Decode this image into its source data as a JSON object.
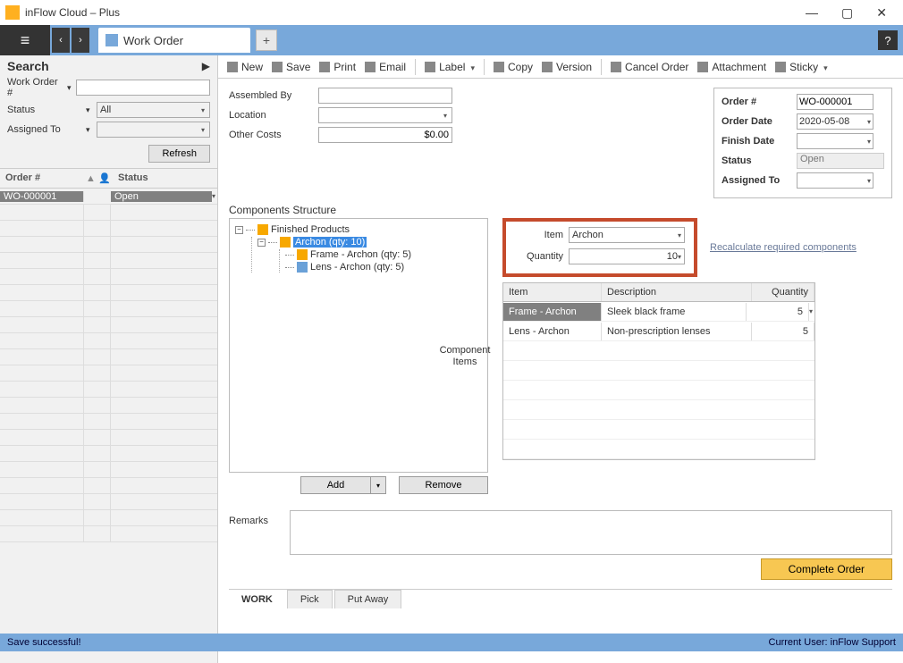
{
  "window": {
    "title": "inFlow Cloud – Plus"
  },
  "tabs": {
    "active": "Work Order",
    "add": "+"
  },
  "toolbar": {
    "new": "New",
    "save": "Save",
    "print": "Print",
    "email": "Email",
    "label": "Label",
    "copy": "Copy",
    "version": "Version",
    "cancel": "Cancel Order",
    "attachment": "Attachment",
    "sticky": "Sticky"
  },
  "search": {
    "heading": "Search",
    "fields": {
      "work_order_no": {
        "label": "Work Order #",
        "value": ""
      },
      "status": {
        "label": "Status",
        "value": "All"
      },
      "assigned_to": {
        "label": "Assigned To",
        "value": ""
      }
    },
    "refresh": "Refresh",
    "columns": {
      "order": "Order #",
      "status": "Status"
    },
    "rows": [
      {
        "order": "WO-000001",
        "status": "Open"
      }
    ]
  },
  "form": {
    "left": {
      "assembled_by": {
        "label": "Assembled By",
        "value": ""
      },
      "location": {
        "label": "Location",
        "value": ""
      },
      "other_costs": {
        "label": "Other Costs",
        "value": "$0.00"
      }
    },
    "right": {
      "order_no": {
        "label": "Order #",
        "value": "WO-000001"
      },
      "order_date": {
        "label": "Order Date",
        "value": "2020-05-08"
      },
      "finish_date": {
        "label": "Finish Date",
        "value": ""
      },
      "status": {
        "label": "Status",
        "value": "Open"
      },
      "assigned_to": {
        "label": "Assigned To",
        "value": ""
      }
    }
  },
  "components": {
    "heading": "Components Structure",
    "tree": {
      "root": "Finished Products",
      "product": "Archon  (qty: 10)",
      "children": [
        "Frame - Archon  (qty: 5)",
        "Lens - Archon  (qty: 5)"
      ]
    },
    "item_field": {
      "label": "Item",
      "value": "Archon"
    },
    "qty_field": {
      "label": "Quantity",
      "value": "10"
    },
    "recalc": "Recalculate required components",
    "component_items_label": "Component Items",
    "grid": {
      "headers": {
        "item": "Item",
        "desc": "Description",
        "qty": "Quantity"
      },
      "rows": [
        {
          "item": "Frame - Archon",
          "desc": "Sleek black frame",
          "qty": "5"
        },
        {
          "item": "Lens - Archon",
          "desc": "Non-prescription lenses",
          "qty": "5"
        }
      ]
    },
    "buttons": {
      "add": "Add",
      "remove": "Remove"
    }
  },
  "remarks": {
    "label": "Remarks",
    "value": ""
  },
  "complete_btn": "Complete Order",
  "bottom_tabs": {
    "work": "WORK",
    "pick": "Pick",
    "putaway": "Put Away"
  },
  "statusbar": {
    "left": "Save successful!",
    "right": "Current User:  inFlow Support"
  }
}
